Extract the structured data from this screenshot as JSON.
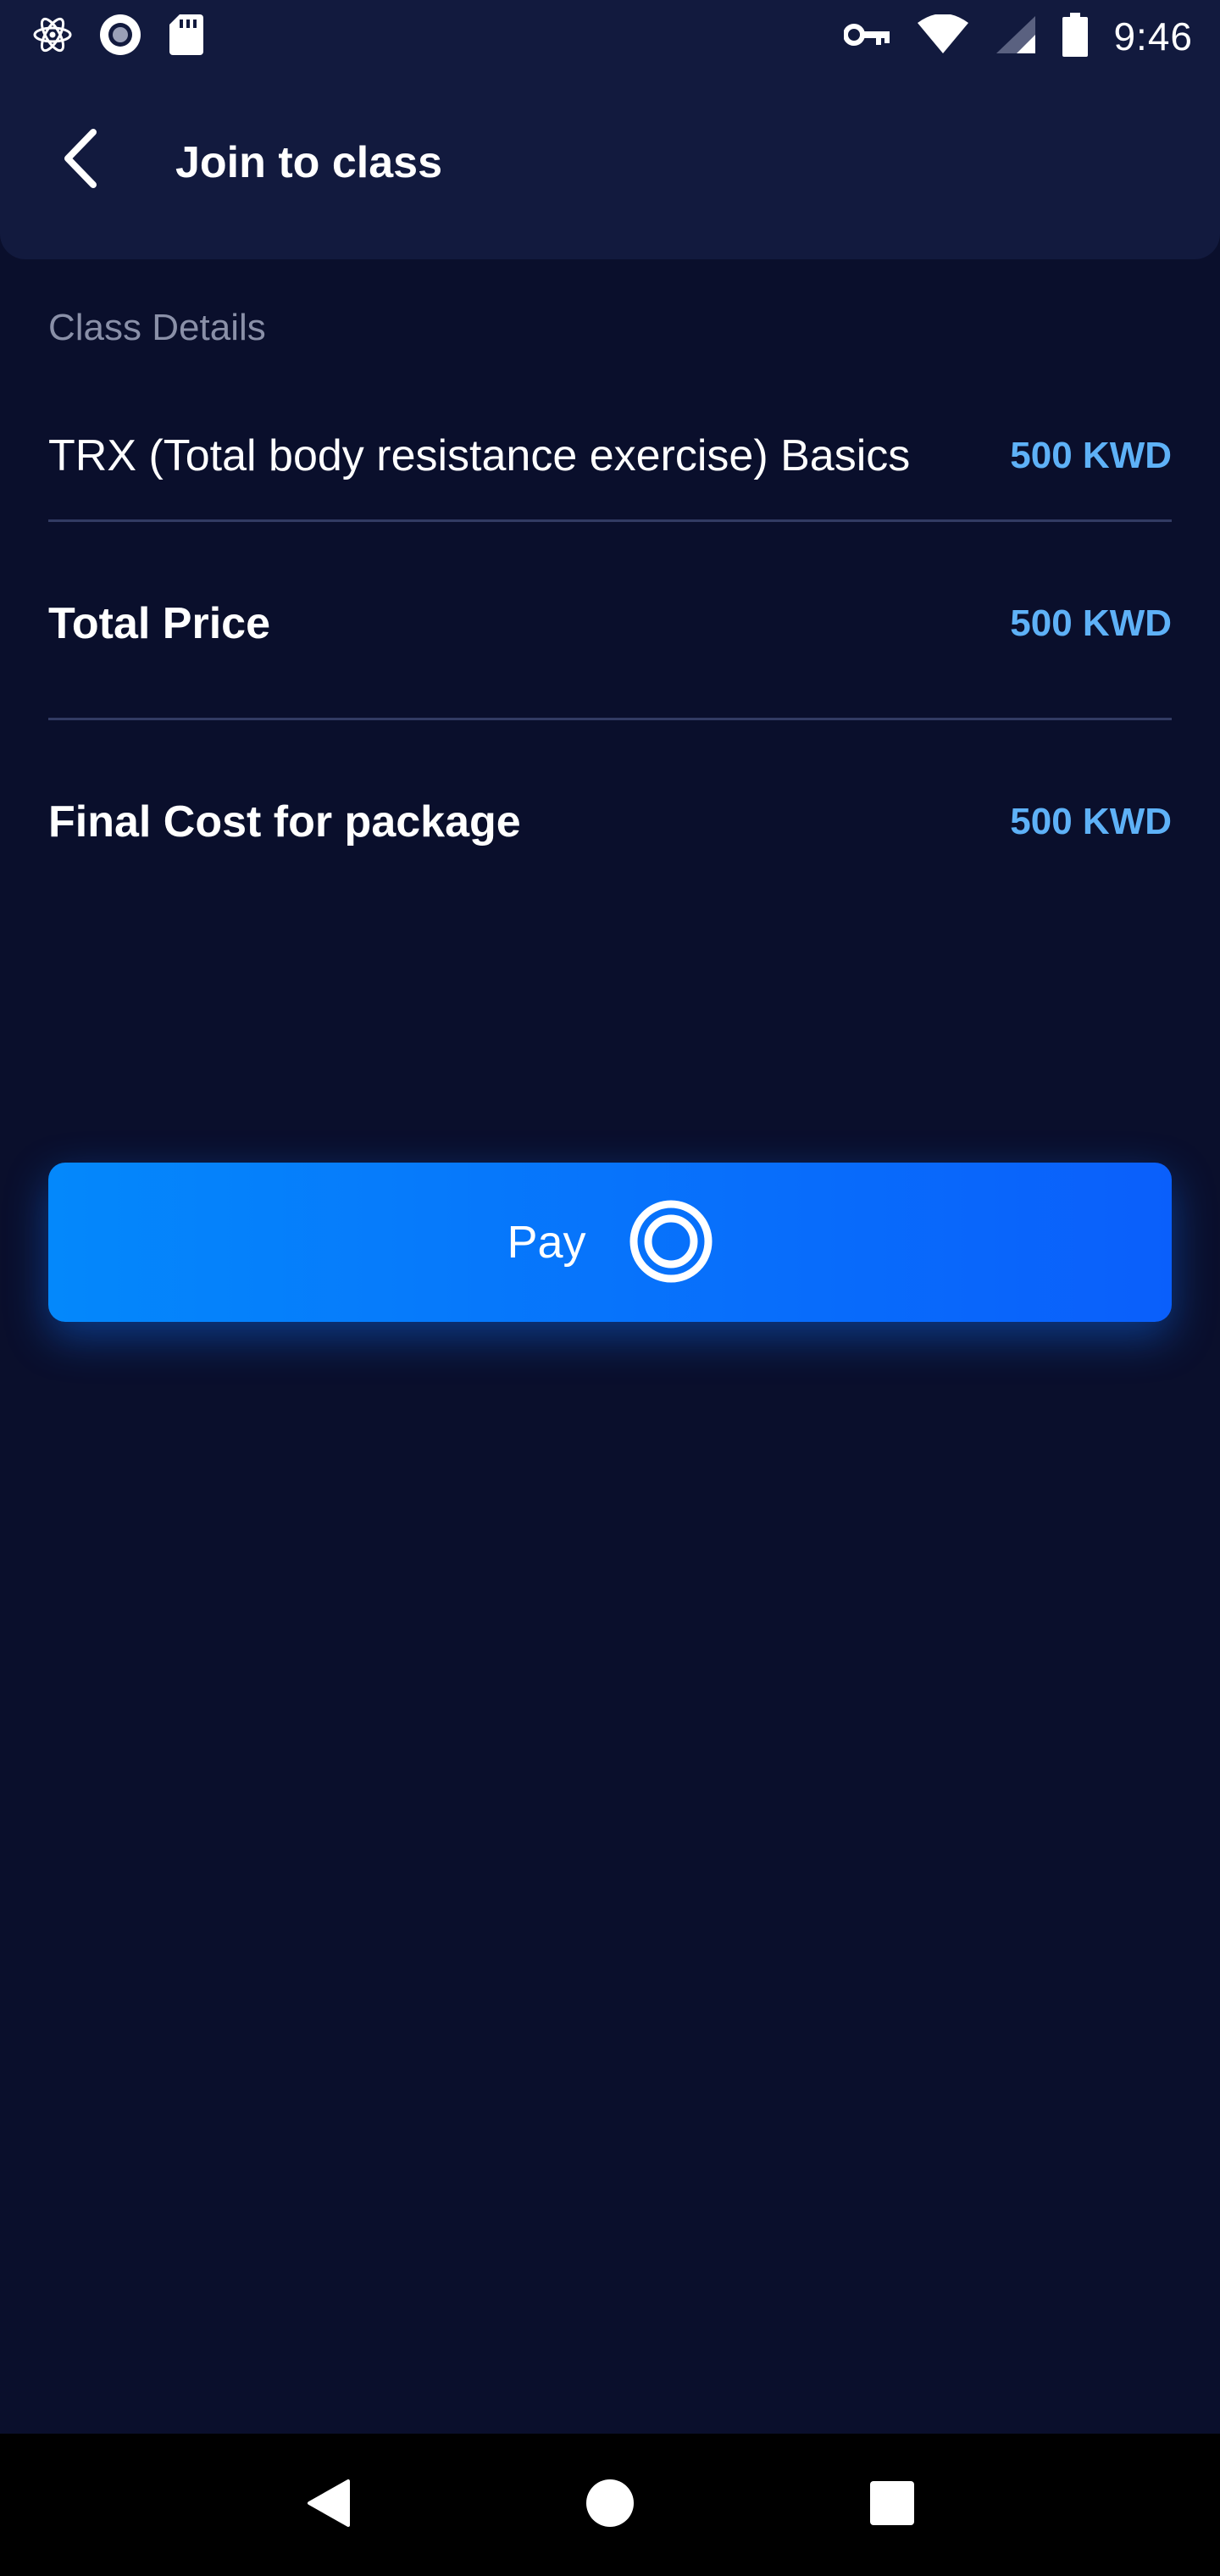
{
  "status_bar": {
    "time": "9:46",
    "left_icons": [
      "react-icon",
      "record-icon",
      "sd-card-icon"
    ],
    "right_icons": [
      "vpn-key-icon",
      "wifi-icon",
      "cell-signal-icon",
      "battery-icon"
    ]
  },
  "app_bar": {
    "title": "Join to class",
    "back_icon": "chevron-left-icon"
  },
  "details": {
    "section_label": "Class Details",
    "class_name": "TRX (Total body resistance exercise) Basics",
    "class_price": "500 KWD",
    "total_label": "Total Price",
    "total_price": "500 KWD",
    "final_label": "Final Cost for package",
    "final_price": "500 KWD"
  },
  "pay_button": {
    "label": "Pay",
    "icon": "target-ring-icon"
  },
  "nav_bar": {
    "buttons": [
      "nav-back-icon",
      "nav-home-icon",
      "nav-recents-icon"
    ]
  },
  "colors": {
    "background": "#0a0f2c",
    "panel": "#121a3e",
    "accent_price": "#5eb1f7",
    "button_gradient_start": "#0488fb",
    "button_gradient_end": "#0a5ffb",
    "muted_text": "#8a90a8",
    "divider": "#323b63"
  }
}
